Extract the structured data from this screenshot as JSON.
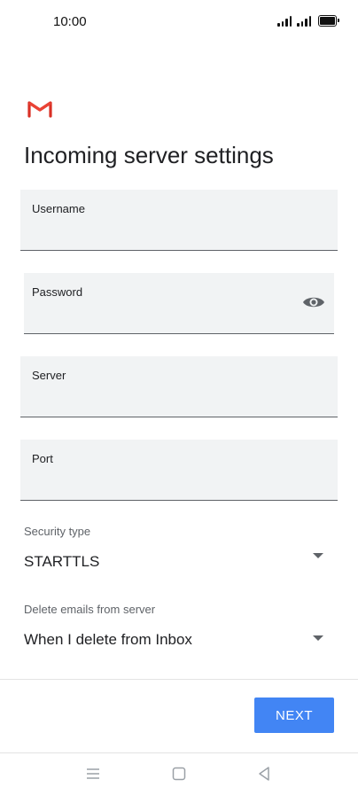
{
  "status_bar": {
    "time": "10:00",
    "battery_level": 1.0
  },
  "header": {
    "logo": "gmail-logo",
    "title": "Incoming server settings"
  },
  "form": {
    "username": {
      "label": "Username",
      "value": ""
    },
    "password": {
      "label": "Password",
      "value": "",
      "toggle_icon": "eye-icon"
    },
    "server": {
      "label": "Server",
      "value": ""
    },
    "port": {
      "label": "Port",
      "value": ""
    },
    "security_type": {
      "label": "Security type",
      "value": "STARTTLS"
    },
    "delete_emails": {
      "label": "Delete emails from server",
      "value": "When I delete from Inbox"
    }
  },
  "actions": {
    "next_label": "NEXT"
  },
  "navigation": {
    "icons": [
      "menu-icon",
      "home-square-icon",
      "back-triangle-icon"
    ]
  },
  "colors": {
    "accent": "#4285f4",
    "field_bg": "#f1f3f4",
    "gmail_red": "#d93025"
  }
}
